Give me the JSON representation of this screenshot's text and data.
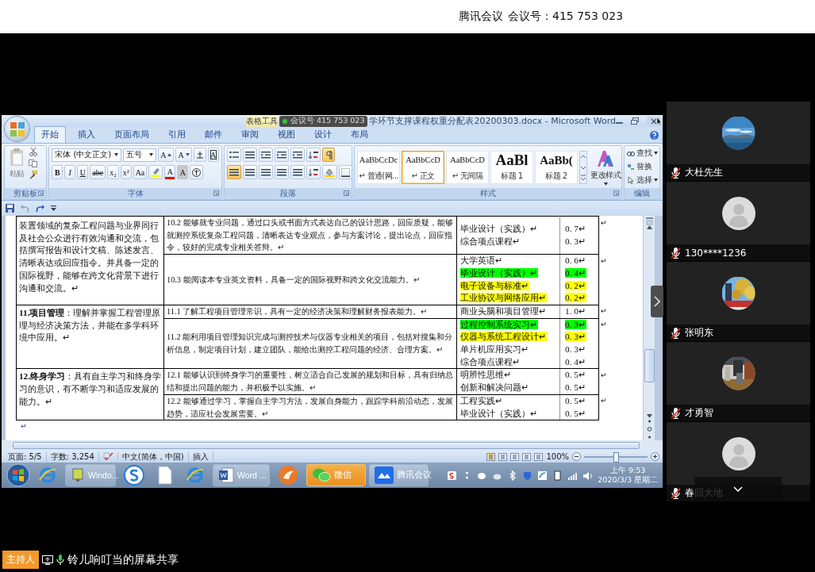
{
  "meeting_header": {
    "app": "腾讯会议",
    "meeting_id": "会议号：415 753 023"
  },
  "shared_window": {
    "contextual_tab_group": "表格工具",
    "meeting_badge": "会议号 415 753 023",
    "title": "学环节支撑课程权重分配表20200303.docx - Microsoft Word",
    "tabs": [
      {
        "label": "开始",
        "selected": true
      },
      {
        "label": "插入",
        "selected": false
      },
      {
        "label": "页面布局",
        "selected": false
      },
      {
        "label": "引用",
        "selected": false
      },
      {
        "label": "邮件",
        "selected": false
      },
      {
        "label": "审阅",
        "selected": false
      },
      {
        "label": "视图",
        "selected": false
      },
      {
        "label": "设计",
        "selected": false
      },
      {
        "label": "布局",
        "selected": false
      }
    ],
    "ribbon": {
      "clipboard": {
        "paste": "粘贴",
        "label": "剪贴板"
      },
      "font": {
        "font_name": "宋体 (中文正文)",
        "font_size": "五号",
        "size_buttons": [
          "A",
          "A"
        ],
        "border_button": "A",
        "format_buttons": [
          "B",
          "I",
          "U",
          "abe",
          "x₂",
          "x²",
          "Aa"
        ],
        "color_buttons": [
          "A",
          "A"
        ],
        "label": "字体"
      },
      "paragraph": {
        "label": "段落"
      },
      "styles": {
        "items": [
          {
            "preview": "AaBbCcDc",
            "name": "↵ 普通(网...",
            "kind": "normal",
            "selected": false
          },
          {
            "preview": "AaBbCcD",
            "name": "↵ 正文",
            "kind": "normal",
            "selected": true
          },
          {
            "preview": "AaBbCcD",
            "name": "↵ 无间隔",
            "kind": "normal",
            "selected": false
          },
          {
            "preview": "AaBl",
            "name": "标题 1",
            "kind": "heading1",
            "selected": false
          },
          {
            "preview": "AaBb(",
            "name": "标题 2",
            "kind": "heading2",
            "selected": false
          }
        ],
        "change_styles": "更改样式",
        "label": "样式"
      },
      "editing": {
        "items": [
          "查找",
          "替换",
          "选择"
        ],
        "label": "编辑"
      }
    },
    "table": {
      "groups": [
        {
          "title": "装置领域的复杂工程问题与业界同行及社会公众进行有效沟通和交流，包括撰写报告和设计文稿、陈述发言、清晰表达或回应指令。并具备一定的国际视野，能够在跨文化背景下进行沟通和交流。↵",
          "indicators": [
            {
              "text": "10.2 能够就专业问题，通过口头或书面方式表达自己的设计思路，回应质疑，能够就测控系统复杂工程问题，清晰表达专业观点，参与方案讨论，提出论点，回应指令，较好的完成专业相关答辩。↵",
              "end_mark": "↵",
              "courses": [
                {
                  "name": "毕业设计（实践）↵",
                  "weight": "0. 7↵"
                },
                {
                  "name": "综合项点课程↵",
                  "weight": "0. 3↵"
                }
              ]
            },
            {
              "text": "10.3 能阅读本专业英文资料，具备一定的国际视野和跨文化交流能力。↵",
              "end_mark": "↵",
              "courses": [
                {
                  "name": "大学英语↵",
                  "weight": "0. 6↵"
                },
                {
                  "name": "毕业设计（实践）↵",
                  "weight": "0. 4↵",
                  "color": "#00ff00"
                },
                {
                  "name": "电子设备与标准↵",
                  "weight": "0. 2↵",
                  "color": "#ffff00"
                },
                {
                  "name": "工业协议与网络应用↵",
                  "weight": "0. 2↵",
                  "color": "#ffff00"
                }
              ]
            }
          ]
        },
        {
          "title": "**11.项目管理**：理解并掌握工程管理原理与经济决策方法，并能在多学科环境中应用。↵",
          "indicators": [
            {
              "text": "11.1 了解工程项目管理常识，具有一定的经济决策和理解财务报表能力。↵",
              "end_mark": "↵",
              "courses": [
                {
                  "name": "商业头脑和项目管理↵",
                  "weight": "1. 0↵"
                }
              ]
            },
            {
              "text": "11.2 能利用项目管理知识完成与测控技术与仪器专业相关的项目，包括对搜集和分析信息，制定项目计划，建立团队，能给出测控工程问题的经济、合理方案。↵",
              "end_mark": "↵",
              "courses": [
                {
                  "name": "过程控制系统实习↵",
                  "weight": "0. 3↵",
                  "color": "#00ff00"
                },
                {
                  "name": "仪器与系统工程设计↵",
                  "weight": "0. 3↵",
                  "color": "#ffff00"
                },
                {
                  "name": "单片机应用实习↵",
                  "weight": "0. 3↵"
                },
                {
                  "name": "综合项点课程↵",
                  "weight": "0. 4↵"
                }
              ]
            }
          ]
        },
        {
          "title": "**12.终身学习**：具有自主学习和终身学习的意识，有不断学习和适应发展的能力。↵",
          "indicators": [
            {
              "text": "12.1 能够认识到终身学习的重要性，树立适合自己发展的规划和目标，具有归纳总结和提出问题的能力，并积极予以实施。↵",
              "end_mark": "↵",
              "courses": [
                {
                  "name": "明辨性思维↵",
                  "weight": "0. 5↵"
                },
                {
                  "name": "创新和解决问题↵",
                  "weight": "0. 5↵"
                }
              ]
            },
            {
              "text": "12.2 能够通过学习，掌握自主学习方法，发展自身能力，跟踪学科前沿动态，发展趋势，适应社会发展需要。↵",
              "end_mark": "↵",
              "courses": [
                {
                  "name": "工程实践↵",
                  "weight": "0. 5↵"
                },
                {
                  "name": "毕业设计（实践）↵",
                  "weight": "0. 5↵"
                }
              ]
            }
          ]
        }
      ],
      "trailing_mark": "↵"
    },
    "status_bar": {
      "page": "页面: 5/5",
      "words": "字数: 3,254",
      "language": "中文(简体，中国)",
      "mode": "插入",
      "zoom": "100%",
      "level": 0.5
    },
    "taskbar": {
      "items": [
        {
          "kind": "icon",
          "selected": false
        },
        {
          "kind": "button",
          "label": "Windo...",
          "selected": false
        },
        {
          "kind": "icon",
          "selected": false
        },
        {
          "kind": "icon",
          "selected": false
        },
        {
          "kind": "icon",
          "selected": false
        },
        {
          "kind": "button",
          "label": "Word ...",
          "selected": false
        },
        {
          "kind": "icon",
          "selected": false
        },
        {
          "kind": "button",
          "label": "微信",
          "selected": true
        },
        {
          "kind": "button",
          "label": "腾讯会议",
          "selected": false
        }
      ],
      "clock": {
        "time": "上午 9:53",
        "date": "2020/3/3 星期二"
      }
    }
  },
  "participants": [
    {
      "name": "大杜先生",
      "muted": true,
      "kind": "picture"
    },
    {
      "name": "130****1236",
      "muted": true,
      "kind": "default"
    },
    {
      "name": "张明东",
      "muted": true,
      "kind": "picture"
    },
    {
      "name": "才勇智",
      "muted": true,
      "kind": "picture"
    },
    {
      "name": "春回大地",
      "muted": true,
      "kind": "default"
    }
  ],
  "host_badge": "主持人",
  "share_label": "铃儿响叮当的屏幕共享"
}
